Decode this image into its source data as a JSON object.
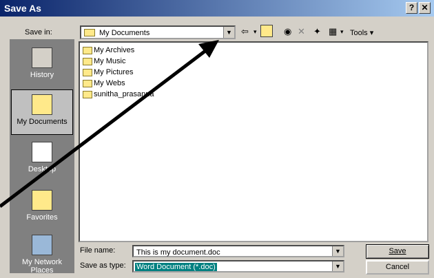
{
  "window": {
    "title": "Save As",
    "help_glyph": "?",
    "close_glyph": "✕"
  },
  "save_in": {
    "label": "Save in:",
    "value": "My Documents"
  },
  "toolbar": {
    "tools_label": "Tools ▾"
  },
  "places": [
    {
      "label": "History"
    },
    {
      "label": "My Documents"
    },
    {
      "label": "Desktop"
    },
    {
      "label": "Favorites"
    },
    {
      "label_line1": "My Network",
      "label_line2": "Places"
    }
  ],
  "files": [
    {
      "name": "My Archives",
      "icon": "folder-icon"
    },
    {
      "name": "My Music",
      "icon": "folder-icon"
    },
    {
      "name": "My Pictures",
      "icon": "folder-icon"
    },
    {
      "name": "My Webs",
      "icon": "folder-icon"
    },
    {
      "name": "sunitha_prasanna",
      "icon": "folder-icon"
    }
  ],
  "file_name": {
    "label": "File name:",
    "value": "This is my document.doc"
  },
  "save_as_type": {
    "label": "Save as type:",
    "value": "Word Document (*.doc)"
  },
  "buttons": {
    "save": "Save",
    "cancel": "Cancel"
  },
  "colors": {
    "title_bar": "#0a246a",
    "dialog": "#d4d0c8",
    "selection": "#008080",
    "arrow": "#000000"
  }
}
